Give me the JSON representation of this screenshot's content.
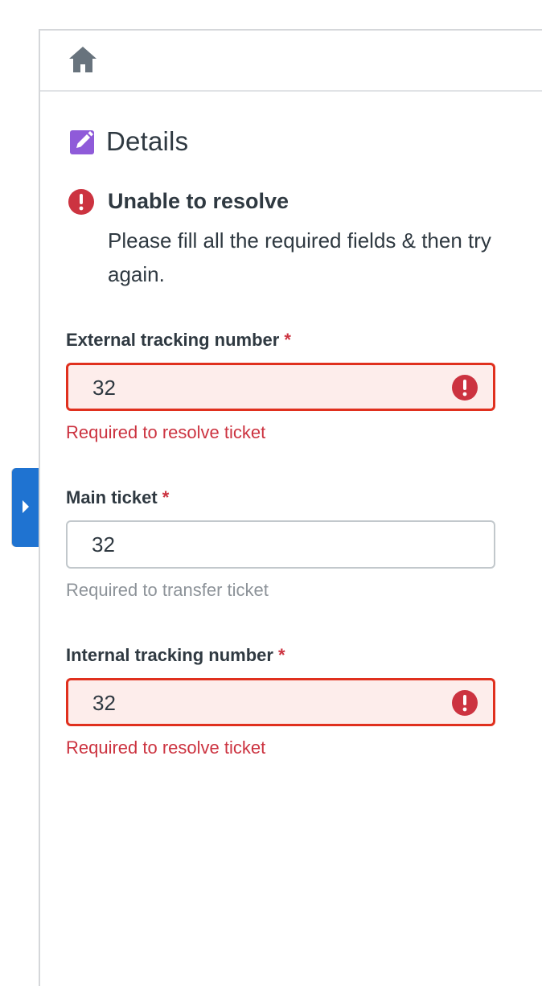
{
  "header": {
    "home_icon": "home-icon"
  },
  "collapse_tab": {
    "icon": "chevron-right-icon",
    "color": "#1f73d1"
  },
  "section": {
    "icon": "edit-icon",
    "title": "Details"
  },
  "alert": {
    "icon": "alert-error-icon",
    "title": "Unable to resolve",
    "message": "Please fill all the required fields & then try again."
  },
  "fields": [
    {
      "label": "External tracking number",
      "required_marker": "*",
      "value": "32",
      "state": "error",
      "hint": "Required to resolve ticket"
    },
    {
      "label": "Main ticket",
      "required_marker": "*",
      "value": "32",
      "state": "normal",
      "hint": "Required to transfer ticket"
    },
    {
      "label": "Internal tracking number",
      "required_marker": "*",
      "value": "32",
      "state": "error",
      "hint": "Required to resolve ticket"
    }
  ],
  "colors": {
    "error": "#e0301e",
    "error_bg": "#fdedeb",
    "accent_purple": "#8f5bd9",
    "text": "#2f3941",
    "muted": "#8d9399"
  }
}
